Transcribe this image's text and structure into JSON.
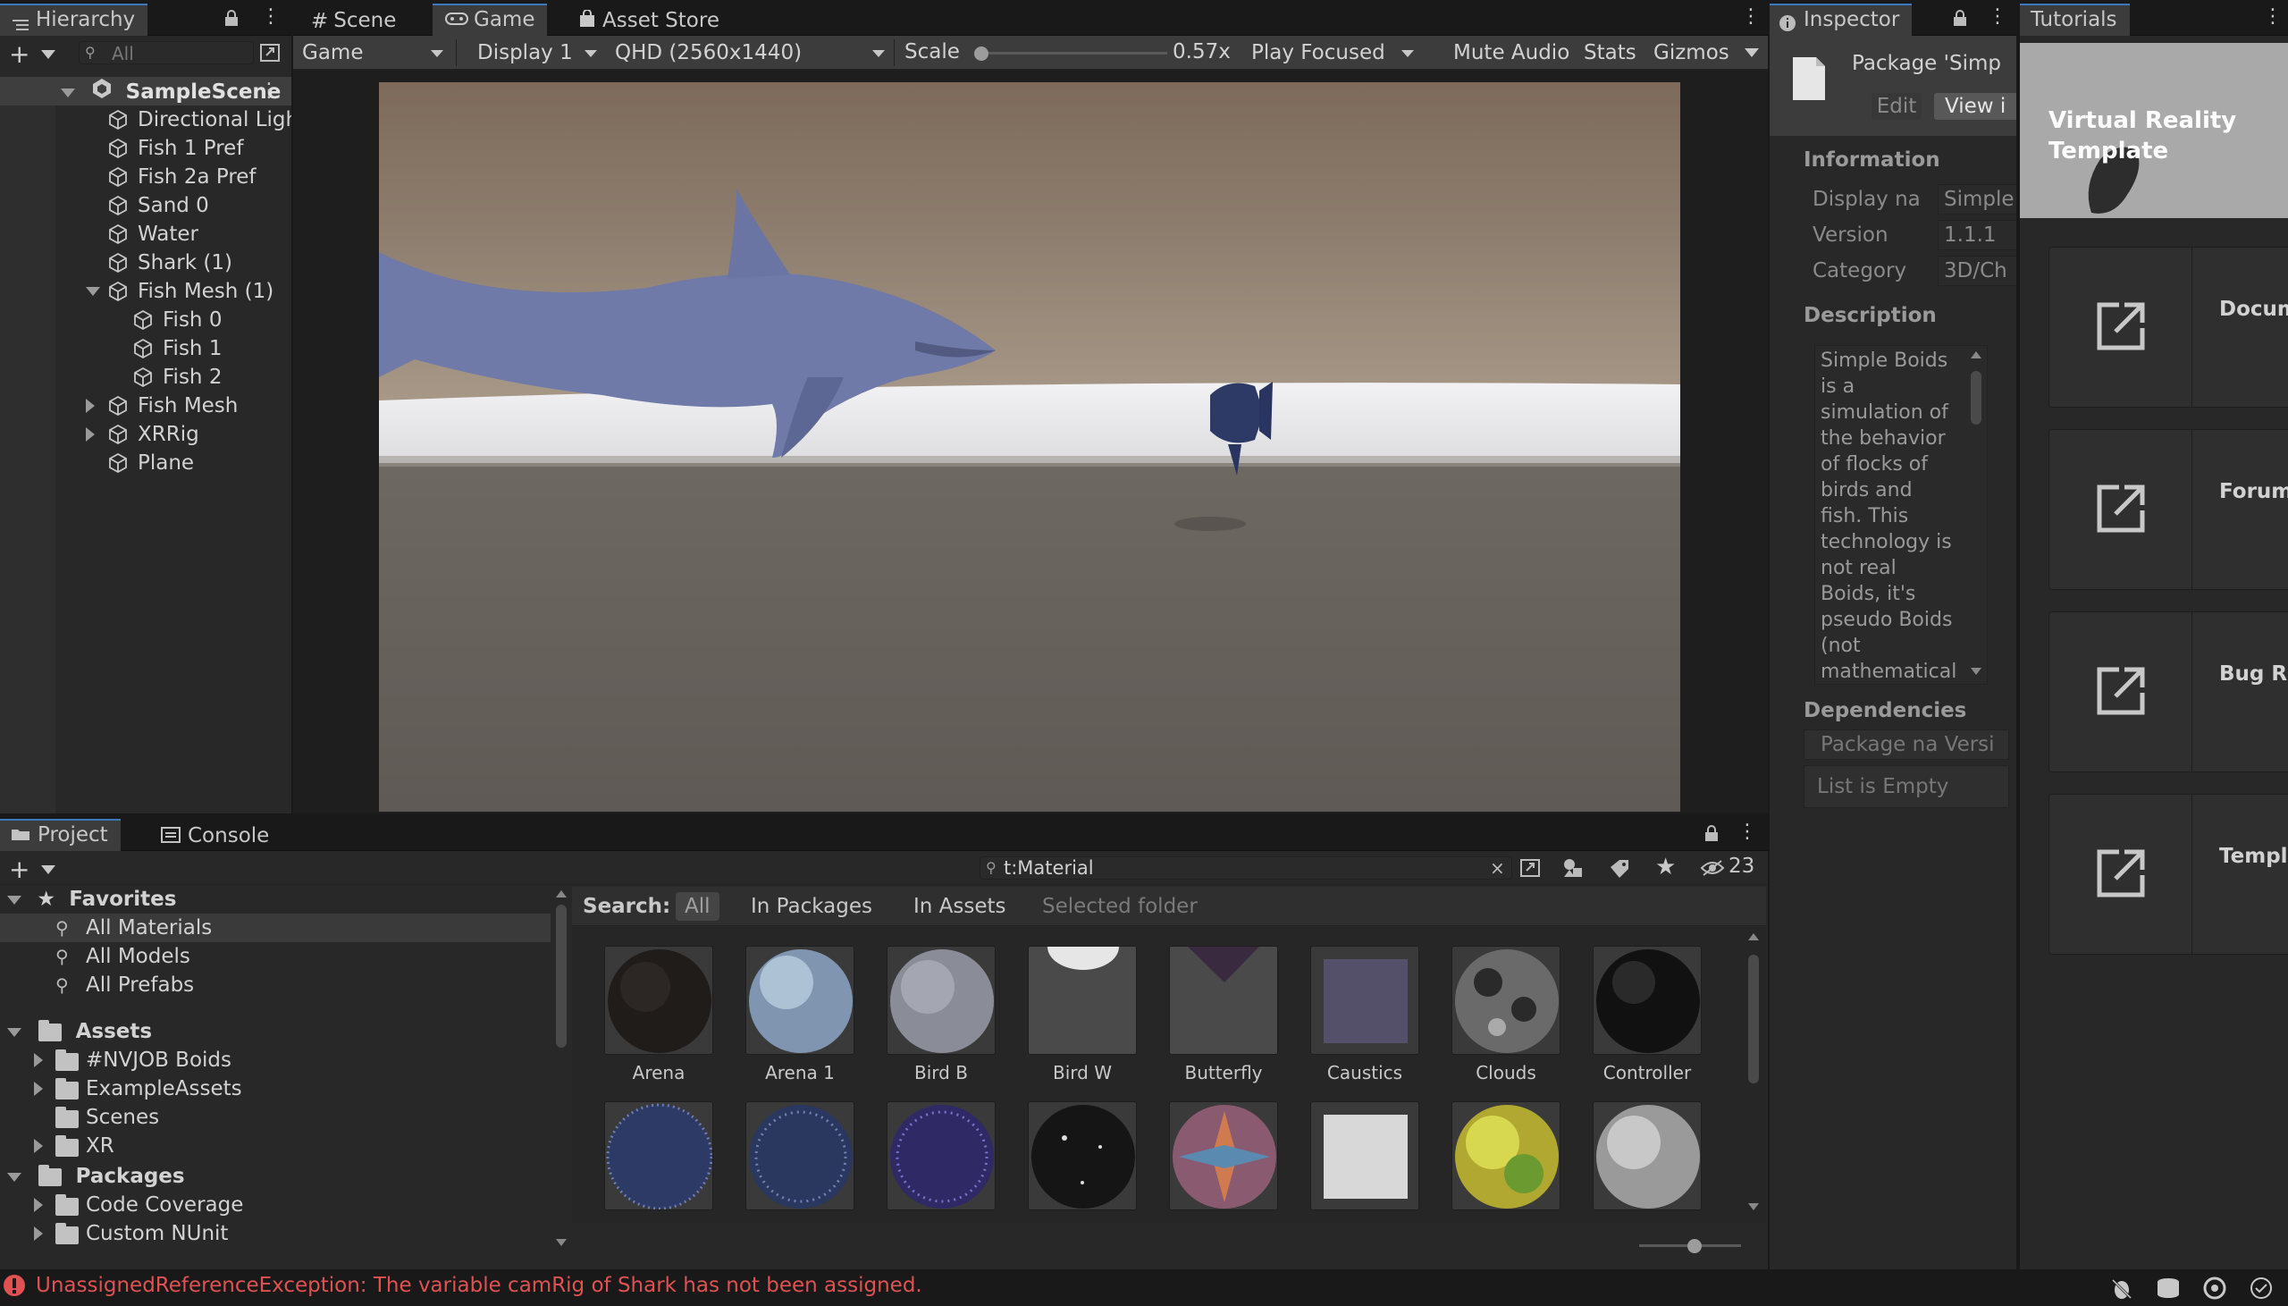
{
  "hierarchy": {
    "tab_label": "Hierarchy",
    "search_placeholder": "All",
    "scene_name": "SampleScene",
    "items": [
      {
        "label": "Directional Light",
        "indent": 1,
        "expander": "none"
      },
      {
        "label": "Fish 1 Pref",
        "indent": 1,
        "expander": "none"
      },
      {
        "label": "Fish 2a Pref",
        "indent": 1,
        "expander": "none"
      },
      {
        "label": "Sand 0",
        "indent": 1,
        "expander": "none"
      },
      {
        "label": "Water",
        "indent": 1,
        "expander": "none"
      },
      {
        "label": "Shark (1)",
        "indent": 1,
        "expander": "none"
      },
      {
        "label": "Fish Mesh (1)",
        "indent": 1,
        "expander": "open"
      },
      {
        "label": "Fish 0",
        "indent": 2,
        "expander": "none"
      },
      {
        "label": "Fish 1",
        "indent": 2,
        "expander": "none"
      },
      {
        "label": "Fish 2",
        "indent": 2,
        "expander": "none"
      },
      {
        "label": "Fish Mesh",
        "indent": 1,
        "expander": "closed"
      },
      {
        "label": "XRRig",
        "indent": 1,
        "expander": "closed"
      },
      {
        "label": "Plane",
        "indent": 1,
        "expander": "none"
      }
    ]
  },
  "center_tabs": {
    "scene": "Scene",
    "game": "Game",
    "asset_store": "Asset Store"
  },
  "game_toolbar": {
    "view_mode": "Game",
    "display": "Display 1",
    "resolution": "QHD (2560x1440)",
    "scale_label": "Scale",
    "scale_value": "0.57x",
    "scale_fraction": 0.0,
    "play_mode": "Play Focused",
    "mute_audio": "Mute Audio",
    "stats": "Stats",
    "gizmos": "Gizmos"
  },
  "inspector": {
    "tab_label": "Inspector",
    "package_title": "Package 'Simp",
    "edit_button": "Edit",
    "view_button": "View i",
    "information_header": "Information",
    "fields": [
      {
        "label": "Display na",
        "value": "Simple"
      },
      {
        "label": "Version",
        "value": "1.1.1"
      },
      {
        "label": "Category",
        "value": "3D/Ch"
      }
    ],
    "description_header": "Description",
    "description_text": "Simple Boids is a simulation of the behavior of flocks of birds and fish. This technology is not real Boids, it's pseudo Boids (not mathematical model), but the basic Boids",
    "dependencies_header": "Dependencies",
    "dep_columns": "Package na Versi",
    "dep_empty": "List is Empty"
  },
  "tutorials": {
    "tab_label": "Tutorials",
    "banner_title": "Virtual Reality Template",
    "cards": [
      "Docum",
      "Forum",
      "Bug Re",
      "Templ"
    ]
  },
  "project": {
    "tab_project": "Project",
    "tab_console": "Console",
    "search_value": "t:Material",
    "hidden_count": "23",
    "favorites_label": "Favorites",
    "favorites": [
      "All Materials",
      "All Models",
      "All Prefabs"
    ],
    "assets_label": "Assets",
    "assets": [
      "#NVJOB Boids",
      "ExampleAssets",
      "Scenes",
      "XR"
    ],
    "packages_label": "Packages",
    "packages": [
      "Code Coverage",
      "Custom NUnit"
    ],
    "search_scope": {
      "label": "Search:",
      "all": "All",
      "in_packages": "In Packages",
      "in_assets": "In Assets",
      "selected_folder": "Selected folder"
    },
    "materials_row1": [
      "Arena",
      "Arena 1",
      "Bird B",
      "Bird W",
      "Butterfly",
      "Caustics",
      "Clouds",
      "Controller"
    ]
  },
  "status_bar": {
    "error_message": "UnassignedReferenceException: The variable camRig of Shark has not been assigned.",
    "error_color": "#e05252"
  },
  "colors": {
    "accent": "#3a79bb",
    "panel": "#282828",
    "toolbar": "#3c3c3c"
  }
}
